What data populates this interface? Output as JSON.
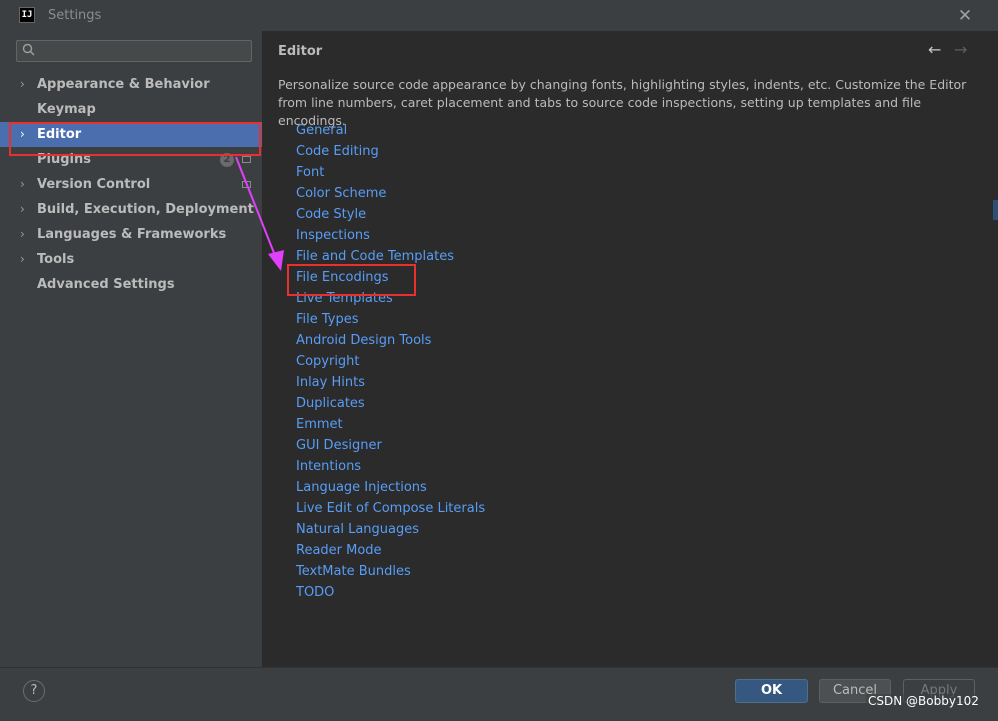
{
  "window": {
    "title": "Settings",
    "app_icon_text": "IJ"
  },
  "sidebar": {
    "search_placeholder": "",
    "items": [
      {
        "label": "Appearance & Behavior",
        "expandable": true
      },
      {
        "label": "Keymap",
        "expandable": false
      },
      {
        "label": "Editor",
        "expandable": true,
        "selected": true
      },
      {
        "label": "Plugins",
        "expandable": false,
        "badge": "2"
      },
      {
        "label": "Version Control",
        "expandable": true
      },
      {
        "label": "Build, Execution, Deployment",
        "expandable": true
      },
      {
        "label": "Languages & Frameworks",
        "expandable": true
      },
      {
        "label": "Tools",
        "expandable": true
      },
      {
        "label": "Advanced Settings",
        "expandable": false
      }
    ]
  },
  "content": {
    "heading": "Editor",
    "description": "Personalize source code appearance by changing fonts, highlighting styles, indents, etc. Customize the Editor from line numbers, caret placement and tabs to source code inspections, setting up templates and file encodings.",
    "links": [
      "General",
      "Code Editing",
      "Font",
      "Color Scheme",
      "Code Style",
      "Inspections",
      "File and Code Templates",
      "File Encodings",
      "Live Templates",
      "File Types",
      "Android Design Tools",
      "Copyright",
      "Inlay Hints",
      "Duplicates",
      "Emmet",
      "GUI Designer",
      "Intentions",
      "Language Injections",
      "Live Edit of Compose Literals",
      "Natural Languages",
      "Reader Mode",
      "TextMate Bundles",
      "TODO"
    ]
  },
  "footer": {
    "help": "?",
    "ok": "OK",
    "cancel": "Cancel",
    "apply": "Apply"
  },
  "watermark": "CSDN @Bobby102",
  "colors": {
    "accent": "#4b6eaf",
    "link": "#589df6",
    "annotation": "#e8312f",
    "arrow": "#e040fb"
  },
  "icons": {
    "search": "search-icon",
    "close": "close-icon",
    "back": "arrow-left-icon",
    "forward": "arrow-right-icon",
    "help": "help-icon"
  }
}
